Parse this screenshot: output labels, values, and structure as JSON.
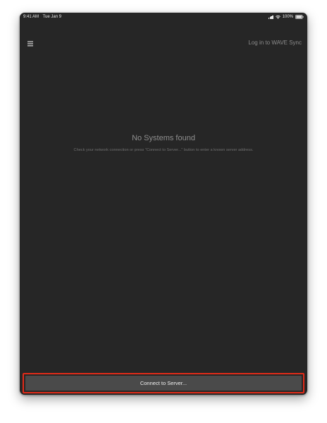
{
  "status_bar": {
    "time": "9:41 AM",
    "date": "Tue Jan 9",
    "battery": "100%"
  },
  "header": {
    "menu_icon": "hamburger-menu-icon",
    "login_label": "Log in to WAVE Sync"
  },
  "empty_state": {
    "title": "No Systems found",
    "description": "Check your network connection or press \"Connect to Server...\" button to enter a known server address."
  },
  "footer": {
    "connect_label": "Connect to Server..."
  },
  "colors": {
    "background": "#262626",
    "button": "#4a4a4a",
    "highlight": "#e22b19"
  }
}
